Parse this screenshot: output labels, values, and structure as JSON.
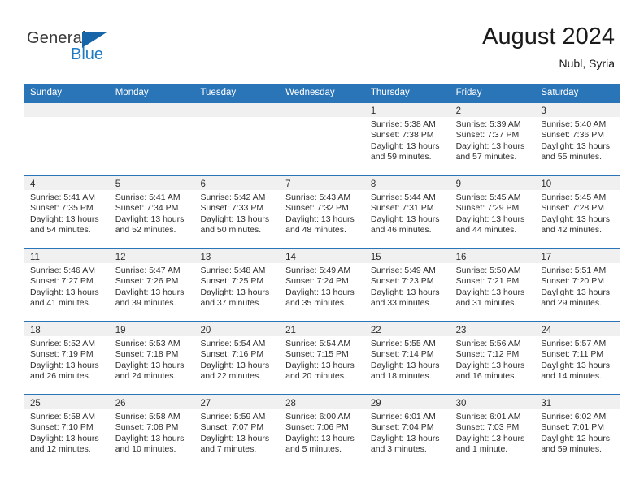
{
  "brand": {
    "name_top": "General",
    "name_bottom": "Blue",
    "triangle_color": "#1565a8",
    "blue_color": "#1f7ac4"
  },
  "header": {
    "title": "August 2024",
    "location": "Nubl, Syria"
  },
  "theme": {
    "header_blue": "#2a74b8",
    "day_strip_gray": "#f0f0f0",
    "text_color": "#2e2e2e"
  },
  "weekdays": [
    "Sunday",
    "Monday",
    "Tuesday",
    "Wednesday",
    "Thursday",
    "Friday",
    "Saturday"
  ],
  "weeks": [
    [
      {
        "day": "",
        "sunrise": "",
        "sunset": "",
        "daylight1": "",
        "daylight2": ""
      },
      {
        "day": "",
        "sunrise": "",
        "sunset": "",
        "daylight1": "",
        "daylight2": ""
      },
      {
        "day": "",
        "sunrise": "",
        "sunset": "",
        "daylight1": "",
        "daylight2": ""
      },
      {
        "day": "",
        "sunrise": "",
        "sunset": "",
        "daylight1": "",
        "daylight2": ""
      },
      {
        "day": "1",
        "sunrise": "Sunrise: 5:38 AM",
        "sunset": "Sunset: 7:38 PM",
        "daylight1": "Daylight: 13 hours",
        "daylight2": "and 59 minutes."
      },
      {
        "day": "2",
        "sunrise": "Sunrise: 5:39 AM",
        "sunset": "Sunset: 7:37 PM",
        "daylight1": "Daylight: 13 hours",
        "daylight2": "and 57 minutes."
      },
      {
        "day": "3",
        "sunrise": "Sunrise: 5:40 AM",
        "sunset": "Sunset: 7:36 PM",
        "daylight1": "Daylight: 13 hours",
        "daylight2": "and 55 minutes."
      }
    ],
    [
      {
        "day": "4",
        "sunrise": "Sunrise: 5:41 AM",
        "sunset": "Sunset: 7:35 PM",
        "daylight1": "Daylight: 13 hours",
        "daylight2": "and 54 minutes."
      },
      {
        "day": "5",
        "sunrise": "Sunrise: 5:41 AM",
        "sunset": "Sunset: 7:34 PM",
        "daylight1": "Daylight: 13 hours",
        "daylight2": "and 52 minutes."
      },
      {
        "day": "6",
        "sunrise": "Sunrise: 5:42 AM",
        "sunset": "Sunset: 7:33 PM",
        "daylight1": "Daylight: 13 hours",
        "daylight2": "and 50 minutes."
      },
      {
        "day": "7",
        "sunrise": "Sunrise: 5:43 AM",
        "sunset": "Sunset: 7:32 PM",
        "daylight1": "Daylight: 13 hours",
        "daylight2": "and 48 minutes."
      },
      {
        "day": "8",
        "sunrise": "Sunrise: 5:44 AM",
        "sunset": "Sunset: 7:31 PM",
        "daylight1": "Daylight: 13 hours",
        "daylight2": "and 46 minutes."
      },
      {
        "day": "9",
        "sunrise": "Sunrise: 5:45 AM",
        "sunset": "Sunset: 7:29 PM",
        "daylight1": "Daylight: 13 hours",
        "daylight2": "and 44 minutes."
      },
      {
        "day": "10",
        "sunrise": "Sunrise: 5:45 AM",
        "sunset": "Sunset: 7:28 PM",
        "daylight1": "Daylight: 13 hours",
        "daylight2": "and 42 minutes."
      }
    ],
    [
      {
        "day": "11",
        "sunrise": "Sunrise: 5:46 AM",
        "sunset": "Sunset: 7:27 PM",
        "daylight1": "Daylight: 13 hours",
        "daylight2": "and 41 minutes."
      },
      {
        "day": "12",
        "sunrise": "Sunrise: 5:47 AM",
        "sunset": "Sunset: 7:26 PM",
        "daylight1": "Daylight: 13 hours",
        "daylight2": "and 39 minutes."
      },
      {
        "day": "13",
        "sunrise": "Sunrise: 5:48 AM",
        "sunset": "Sunset: 7:25 PM",
        "daylight1": "Daylight: 13 hours",
        "daylight2": "and 37 minutes."
      },
      {
        "day": "14",
        "sunrise": "Sunrise: 5:49 AM",
        "sunset": "Sunset: 7:24 PM",
        "daylight1": "Daylight: 13 hours",
        "daylight2": "and 35 minutes."
      },
      {
        "day": "15",
        "sunrise": "Sunrise: 5:49 AM",
        "sunset": "Sunset: 7:23 PM",
        "daylight1": "Daylight: 13 hours",
        "daylight2": "and 33 minutes."
      },
      {
        "day": "16",
        "sunrise": "Sunrise: 5:50 AM",
        "sunset": "Sunset: 7:21 PM",
        "daylight1": "Daylight: 13 hours",
        "daylight2": "and 31 minutes."
      },
      {
        "day": "17",
        "sunrise": "Sunrise: 5:51 AM",
        "sunset": "Sunset: 7:20 PM",
        "daylight1": "Daylight: 13 hours",
        "daylight2": "and 29 minutes."
      }
    ],
    [
      {
        "day": "18",
        "sunrise": "Sunrise: 5:52 AM",
        "sunset": "Sunset: 7:19 PM",
        "daylight1": "Daylight: 13 hours",
        "daylight2": "and 26 minutes."
      },
      {
        "day": "19",
        "sunrise": "Sunrise: 5:53 AM",
        "sunset": "Sunset: 7:18 PM",
        "daylight1": "Daylight: 13 hours",
        "daylight2": "and 24 minutes."
      },
      {
        "day": "20",
        "sunrise": "Sunrise: 5:54 AM",
        "sunset": "Sunset: 7:16 PM",
        "daylight1": "Daylight: 13 hours",
        "daylight2": "and 22 minutes."
      },
      {
        "day": "21",
        "sunrise": "Sunrise: 5:54 AM",
        "sunset": "Sunset: 7:15 PM",
        "daylight1": "Daylight: 13 hours",
        "daylight2": "and 20 minutes."
      },
      {
        "day": "22",
        "sunrise": "Sunrise: 5:55 AM",
        "sunset": "Sunset: 7:14 PM",
        "daylight1": "Daylight: 13 hours",
        "daylight2": "and 18 minutes."
      },
      {
        "day": "23",
        "sunrise": "Sunrise: 5:56 AM",
        "sunset": "Sunset: 7:12 PM",
        "daylight1": "Daylight: 13 hours",
        "daylight2": "and 16 minutes."
      },
      {
        "day": "24",
        "sunrise": "Sunrise: 5:57 AM",
        "sunset": "Sunset: 7:11 PM",
        "daylight1": "Daylight: 13 hours",
        "daylight2": "and 14 minutes."
      }
    ],
    [
      {
        "day": "25",
        "sunrise": "Sunrise: 5:58 AM",
        "sunset": "Sunset: 7:10 PM",
        "daylight1": "Daylight: 13 hours",
        "daylight2": "and 12 minutes."
      },
      {
        "day": "26",
        "sunrise": "Sunrise: 5:58 AM",
        "sunset": "Sunset: 7:08 PM",
        "daylight1": "Daylight: 13 hours",
        "daylight2": "and 10 minutes."
      },
      {
        "day": "27",
        "sunrise": "Sunrise: 5:59 AM",
        "sunset": "Sunset: 7:07 PM",
        "daylight1": "Daylight: 13 hours",
        "daylight2": "and 7 minutes."
      },
      {
        "day": "28",
        "sunrise": "Sunrise: 6:00 AM",
        "sunset": "Sunset: 7:06 PM",
        "daylight1": "Daylight: 13 hours",
        "daylight2": "and 5 minutes."
      },
      {
        "day": "29",
        "sunrise": "Sunrise: 6:01 AM",
        "sunset": "Sunset: 7:04 PM",
        "daylight1": "Daylight: 13 hours",
        "daylight2": "and 3 minutes."
      },
      {
        "day": "30",
        "sunrise": "Sunrise: 6:01 AM",
        "sunset": "Sunset: 7:03 PM",
        "daylight1": "Daylight: 13 hours",
        "daylight2": "and 1 minute."
      },
      {
        "day": "31",
        "sunrise": "Sunrise: 6:02 AM",
        "sunset": "Sunset: 7:01 PM",
        "daylight1": "Daylight: 12 hours",
        "daylight2": "and 59 minutes."
      }
    ]
  ]
}
